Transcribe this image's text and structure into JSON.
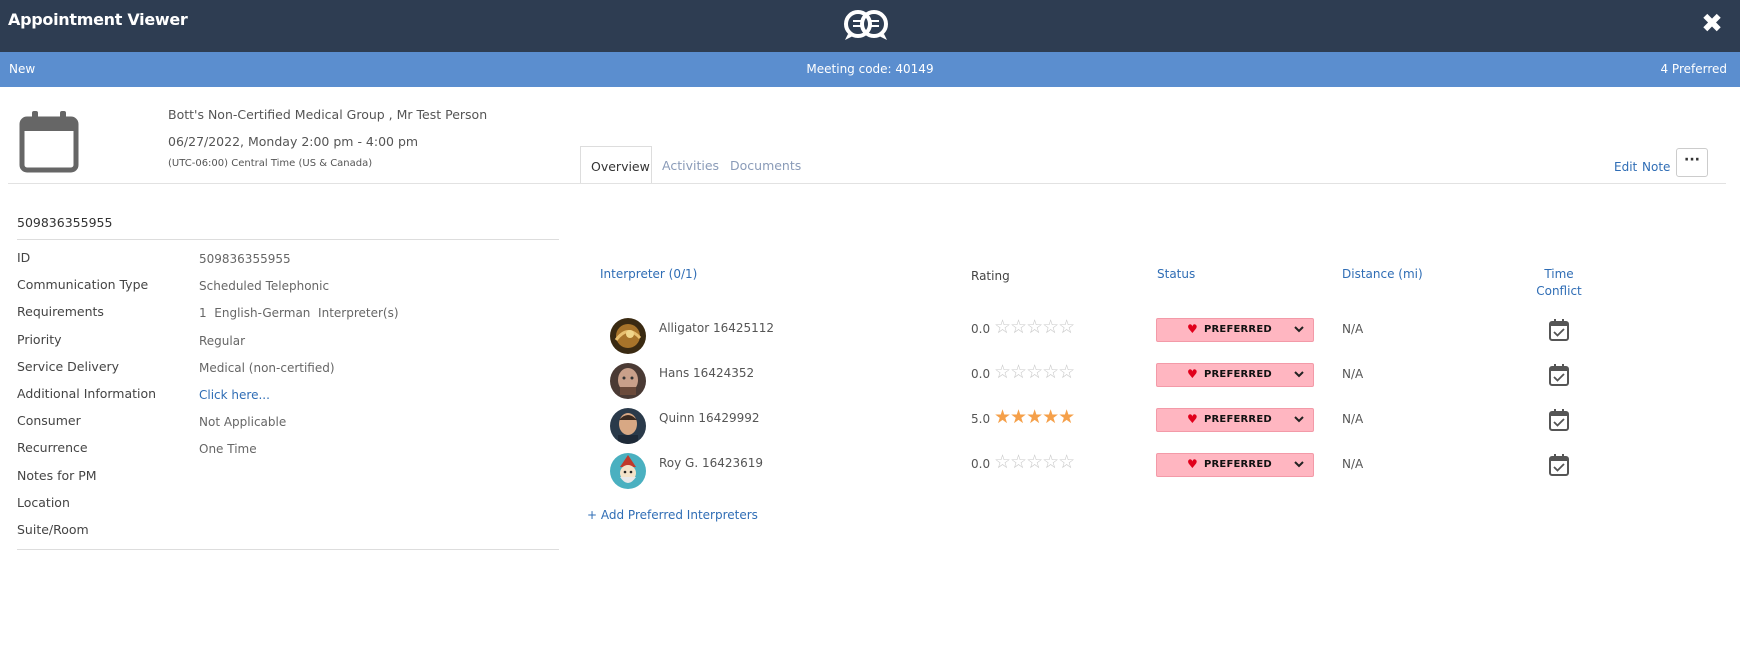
{
  "header": {
    "title": "Appointment Viewer",
    "logo_icon": "double-chat-bubble-logo",
    "close_icon": "close-icon"
  },
  "status_bar": {
    "left": "New",
    "center": "Meeting code: 40149",
    "right": "4 Preferred",
    "color": "#5b8ecf"
  },
  "appointment": {
    "client": "Bott's Non-Certified Medical Group , Mr Test Person",
    "datetime": "06/27/2022, Monday 2:00 pm - 4:00 pm",
    "timezone": "(UTC-06:00) Central Time (US & Canada)"
  },
  "tabs": [
    {
      "label": "Overview",
      "active": true
    },
    {
      "label": "Activities",
      "active": false
    },
    {
      "label": "Documents",
      "active": false
    }
  ],
  "actions": {
    "edit": "Edit",
    "note": "Note",
    "more": "···"
  },
  "details": {
    "title": "509836355955",
    "rows": [
      {
        "label": "ID",
        "value": "509836355955"
      },
      {
        "label": "Communication Type",
        "value": "Scheduled Telephonic"
      },
      {
        "label": "Requirements",
        "value": "1  English-German  Interpreter(s)"
      },
      {
        "label": "Priority",
        "value": "Regular"
      },
      {
        "label": "Service Delivery",
        "value": "Medical (non-certified)"
      },
      {
        "label": "Additional Information",
        "value": "Click here..."
      },
      {
        "label": "Consumer",
        "value": "Not Applicable"
      },
      {
        "label": "Recurrence",
        "value": "One Time"
      },
      {
        "label": "Notes for PM",
        "value": ""
      },
      {
        "label": "Location",
        "value": ""
      },
      {
        "label": "Suite/Room",
        "value": ""
      }
    ]
  },
  "interpreters": {
    "columns": {
      "interpreter": "Interpreter (0/1)",
      "rating": "Rating",
      "status": "Status",
      "distance": "Distance (mi)",
      "time_conflict_line1": "Time",
      "time_conflict_line2": "Conflict"
    },
    "rows": [
      {
        "name": "Alligator 16425112",
        "rating": "0.0",
        "stars": 0,
        "status": "PREFERRED",
        "distance": "N/A"
      },
      {
        "name": "Hans 16424352",
        "rating": "0.0",
        "stars": 0,
        "status": "PREFERRED",
        "distance": "N/A"
      },
      {
        "name": "Quinn 16429992",
        "rating": "5.0",
        "stars": 5,
        "status": "PREFERRED",
        "distance": "N/A"
      },
      {
        "name": "Roy G. 16423619",
        "rating": "0.0",
        "stars": 0,
        "status": "PREFERRED",
        "distance": "N/A"
      }
    ],
    "add_link": "+ Add Preferred Interpreters",
    "status_color": "#ffb6c1",
    "star_color": "#f5a04a"
  }
}
